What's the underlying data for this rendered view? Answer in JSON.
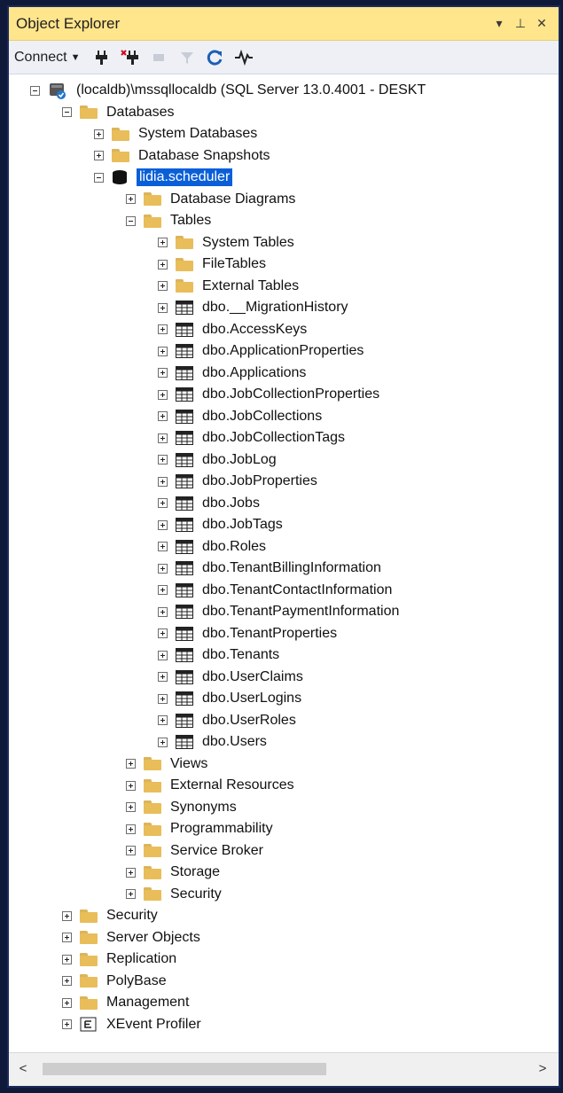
{
  "panel": {
    "title": "Object Explorer",
    "pin_glyph": "▾",
    "pushpin_glyph": "⊥",
    "close_glyph": "✕"
  },
  "toolbar": {
    "connect_label": "Connect",
    "icons": [
      "connect-plug-icon",
      "disconnect-icon",
      "stop-icon",
      "filter-icon",
      "refresh-icon",
      "activity-monitor-icon"
    ]
  },
  "tree": [
    {
      "label": "(localdb)\\mssqllocaldb (SQL Server 13.0.4001 - DESKT",
      "icon": "server-icon",
      "depth": 0,
      "expander": "minus"
    },
    {
      "label": "Databases",
      "icon": "folder-icon",
      "depth": 1,
      "expander": "minus"
    },
    {
      "label": "System Databases",
      "icon": "folder-icon",
      "depth": 2,
      "expander": "plus"
    },
    {
      "label": "Database Snapshots",
      "icon": "folder-icon",
      "depth": 2,
      "expander": "plus"
    },
    {
      "label": "lidia.scheduler",
      "icon": "database-icon",
      "depth": 2,
      "expander": "minus",
      "selected": true
    },
    {
      "label": "Database Diagrams",
      "icon": "folder-icon",
      "depth": 3,
      "expander": "plus"
    },
    {
      "label": "Tables",
      "icon": "folder-icon",
      "depth": 3,
      "expander": "minus"
    },
    {
      "label": "System Tables",
      "icon": "folder-icon",
      "depth": 4,
      "expander": "plus"
    },
    {
      "label": "FileTables",
      "icon": "folder-icon",
      "depth": 4,
      "expander": "plus"
    },
    {
      "label": "External Tables",
      "icon": "folder-icon",
      "depth": 4,
      "expander": "plus"
    },
    {
      "label": "dbo.__MigrationHistory",
      "icon": "table-icon",
      "depth": 4,
      "expander": "plus"
    },
    {
      "label": "dbo.AccessKeys",
      "icon": "table-icon",
      "depth": 4,
      "expander": "plus"
    },
    {
      "label": "dbo.ApplicationProperties",
      "icon": "table-icon",
      "depth": 4,
      "expander": "plus"
    },
    {
      "label": "dbo.Applications",
      "icon": "table-icon",
      "depth": 4,
      "expander": "plus"
    },
    {
      "label": "dbo.JobCollectionProperties",
      "icon": "table-icon",
      "depth": 4,
      "expander": "plus"
    },
    {
      "label": "dbo.JobCollections",
      "icon": "table-icon",
      "depth": 4,
      "expander": "plus"
    },
    {
      "label": "dbo.JobCollectionTags",
      "icon": "table-icon",
      "depth": 4,
      "expander": "plus"
    },
    {
      "label": "dbo.JobLog",
      "icon": "table-icon",
      "depth": 4,
      "expander": "plus"
    },
    {
      "label": "dbo.JobProperties",
      "icon": "table-icon",
      "depth": 4,
      "expander": "plus"
    },
    {
      "label": "dbo.Jobs",
      "icon": "table-icon",
      "depth": 4,
      "expander": "plus"
    },
    {
      "label": "dbo.JobTags",
      "icon": "table-icon",
      "depth": 4,
      "expander": "plus"
    },
    {
      "label": "dbo.Roles",
      "icon": "table-icon",
      "depth": 4,
      "expander": "plus"
    },
    {
      "label": "dbo.TenantBillingInformation",
      "icon": "table-icon",
      "depth": 4,
      "expander": "plus"
    },
    {
      "label": "dbo.TenantContactInformation",
      "icon": "table-icon",
      "depth": 4,
      "expander": "plus"
    },
    {
      "label": "dbo.TenantPaymentInformation",
      "icon": "table-icon",
      "depth": 4,
      "expander": "plus"
    },
    {
      "label": "dbo.TenantProperties",
      "icon": "table-icon",
      "depth": 4,
      "expander": "plus"
    },
    {
      "label": "dbo.Tenants",
      "icon": "table-icon",
      "depth": 4,
      "expander": "plus"
    },
    {
      "label": "dbo.UserClaims",
      "icon": "table-icon",
      "depth": 4,
      "expander": "plus"
    },
    {
      "label": "dbo.UserLogins",
      "icon": "table-icon",
      "depth": 4,
      "expander": "plus"
    },
    {
      "label": "dbo.UserRoles",
      "icon": "table-icon",
      "depth": 4,
      "expander": "plus"
    },
    {
      "label": "dbo.Users",
      "icon": "table-icon",
      "depth": 4,
      "expander": "plus"
    },
    {
      "label": "Views",
      "icon": "folder-icon",
      "depth": 3,
      "expander": "plus"
    },
    {
      "label": "External Resources",
      "icon": "folder-icon",
      "depth": 3,
      "expander": "plus"
    },
    {
      "label": "Synonyms",
      "icon": "folder-icon",
      "depth": 3,
      "expander": "plus"
    },
    {
      "label": "Programmability",
      "icon": "folder-icon",
      "depth": 3,
      "expander": "plus"
    },
    {
      "label": "Service Broker",
      "icon": "folder-icon",
      "depth": 3,
      "expander": "plus"
    },
    {
      "label": "Storage",
      "icon": "folder-icon",
      "depth": 3,
      "expander": "plus"
    },
    {
      "label": "Security",
      "icon": "folder-icon",
      "depth": 3,
      "expander": "plus"
    },
    {
      "label": "Security",
      "icon": "folder-icon",
      "depth": 1,
      "expander": "plus"
    },
    {
      "label": "Server Objects",
      "icon": "folder-icon",
      "depth": 1,
      "expander": "plus"
    },
    {
      "label": "Replication",
      "icon": "folder-icon",
      "depth": 1,
      "expander": "plus"
    },
    {
      "label": "PolyBase",
      "icon": "folder-icon",
      "depth": 1,
      "expander": "plus"
    },
    {
      "label": "Management",
      "icon": "folder-icon",
      "depth": 1,
      "expander": "plus"
    },
    {
      "label": "XEvent Profiler",
      "icon": "xevent-icon",
      "depth": 1,
      "expander": "plus"
    }
  ],
  "scrollbar": {
    "left_arrow": "<",
    "right_arrow": ">"
  },
  "colors": {
    "title_bar": "#ffe58c",
    "selection": "#0a5fd8",
    "folder": "#e8bd5a"
  }
}
